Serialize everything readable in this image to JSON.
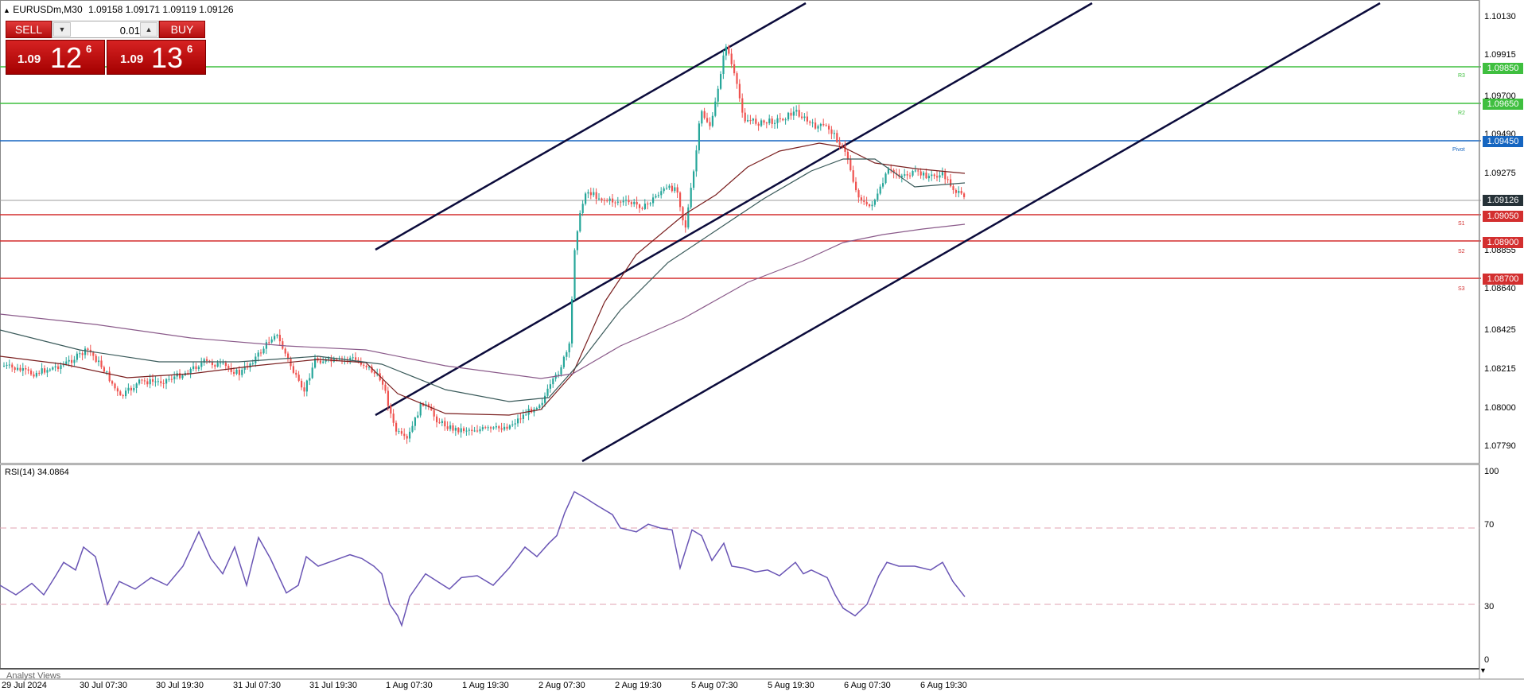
{
  "header": {
    "symbol": "EURUSDm,M30",
    "ohlc": "1.09158 1.09171 1.09119 1.09126"
  },
  "trade_panel": {
    "sell_label": "SELL",
    "buy_label": "BUY",
    "lot_value": "0.01",
    "sell_price": {
      "big": "1.09",
      "mid": "12",
      "point": "6"
    },
    "buy_price": {
      "big": "1.09",
      "mid": "13",
      "point": "6"
    }
  },
  "price_axis": {
    "ticks": [
      "1.10130",
      "1.09915",
      "1.09700",
      "1.09490",
      "1.09275",
      "1.08855",
      "1.08640",
      "1.08425",
      "1.08215",
      "1.08000",
      "1.07790"
    ],
    "current_price": "1.09126"
  },
  "levels": [
    {
      "name": "R3",
      "price": "1.09850",
      "color": "#3fbf3f"
    },
    {
      "name": "R2",
      "price": "1.09650",
      "color": "#3fbf3f"
    },
    {
      "name": "Pivot",
      "price": "1.09450",
      "color": "#1565c0"
    },
    {
      "name": "S1",
      "price": "1.09050",
      "color": "#d32f2f"
    },
    {
      "name": "S2",
      "price": "1.08900",
      "color": "#d32f2f"
    },
    {
      "name": "S3",
      "price": "1.08700",
      "color": "#d32f2f"
    }
  ],
  "rsi": {
    "label": "RSI(14) 34.0864",
    "axis": [
      "100",
      "70",
      "30",
      "0"
    ],
    "line_color": "#6a55b5"
  },
  "time_axis": [
    "29 Jul 2024",
    "30 Jul 07:30",
    "30 Jul 19:30",
    "31 Jul 07:30",
    "31 Jul 19:30",
    "1 Aug 07:30",
    "1 Aug 19:30",
    "2 Aug 07:30",
    "2 Aug 19:30",
    "5 Aug 07:30",
    "5 Aug 19:30",
    "6 Aug 07:30",
    "6 Aug 19:30"
  ],
  "bottom_tab": "Analyst Views",
  "colors": {
    "bull": "#26a69a",
    "bear": "#ef5350",
    "channel": "#0b0b3b",
    "ma_fast": "#7a1f1f",
    "ma_mid": "#3a5a5a",
    "ma_slow": "#8a5a8a"
  }
}
